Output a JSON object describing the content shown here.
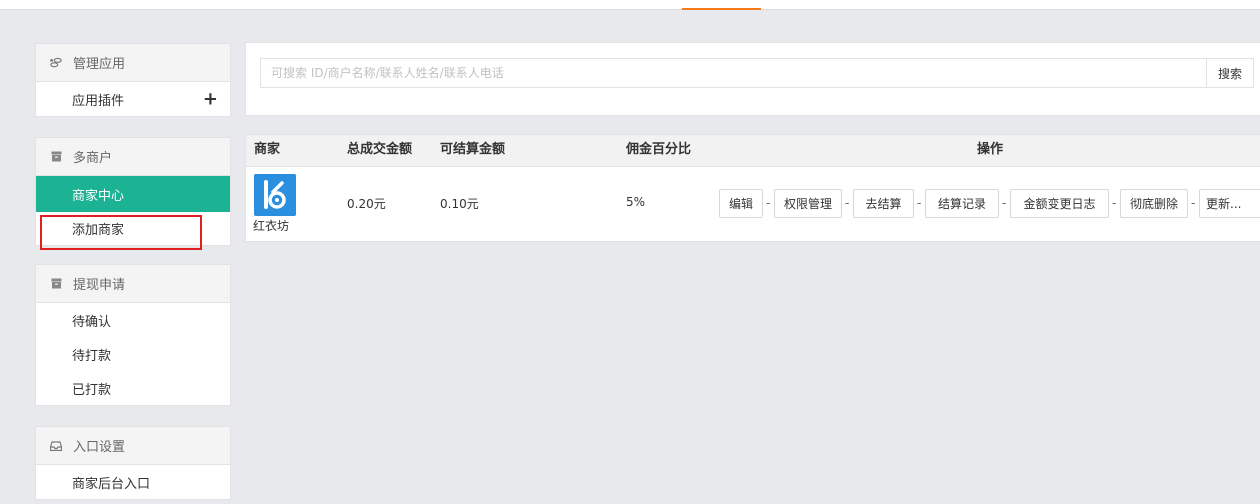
{
  "sidebar": {
    "apps": {
      "title": "管理应用",
      "items": [
        {
          "label": "应用插件"
        }
      ]
    },
    "merchants": {
      "title": "多商户",
      "items": [
        {
          "label": "商家中心"
        },
        {
          "label": "添加商家"
        }
      ]
    },
    "withdraw": {
      "title": "提现申请",
      "items": [
        {
          "label": "待确认"
        },
        {
          "label": "待打款"
        },
        {
          "label": "已打款"
        }
      ]
    },
    "entry": {
      "title": "入口设置",
      "items": [
        {
          "label": "商家后台入口"
        }
      ]
    }
  },
  "search": {
    "placeholder": "可搜索 ID/商户名称/联系人姓名/联系人电话",
    "value": "",
    "button_label": "搜索"
  },
  "table": {
    "columns": [
      "商家",
      "总成交金额",
      "可结算金额",
      "佣金百分比",
      "操作"
    ],
    "rows": [
      {
        "merchant": "红衣坊",
        "total_amount": "0.20元",
        "settleable_amount": "0.10元",
        "commission": "5%",
        "actions": [
          "编辑",
          "权限管理",
          "去结算",
          "结算记录",
          "金额变更日志",
          "彻底删除",
          "更新..."
        ],
        "separator": "-"
      }
    ]
  },
  "colors": {
    "accent": "#1bb394",
    "tab_indicator": "#f37b1d",
    "highlight": "#e02020",
    "logo_bg": "#2b8fe0"
  }
}
